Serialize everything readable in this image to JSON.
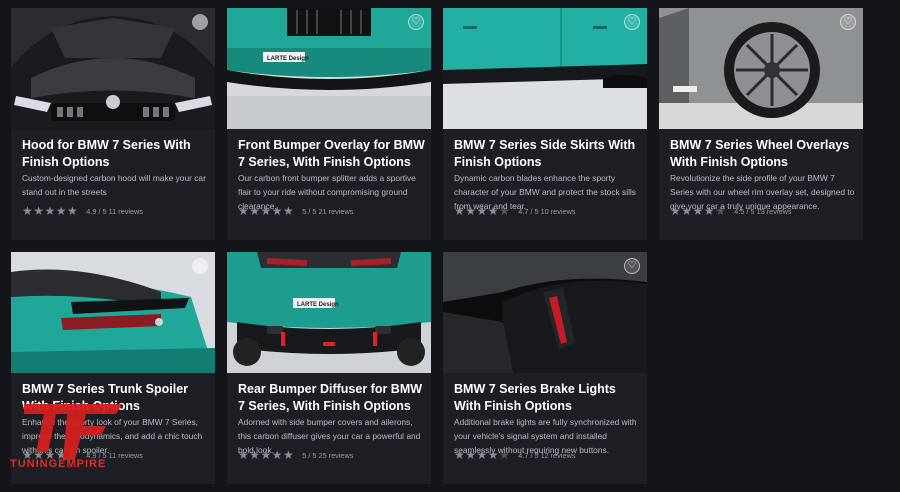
{
  "products": [
    {
      "title": "Hood for BMW 7 Series With Finish Options",
      "description": "Custom-designed carbon hood will make your car stand out in the streets",
      "rating_text": "4.9 / 5  11 reviews",
      "stars": 5,
      "image": "carbon-hood-photo"
    },
    {
      "title": "Front Bumper Overlay for BMW 7 Series, With Finish Options",
      "description": "Our carbon front bumper splitter adds a sportive flair to your ride without compromising ground clearance.",
      "rating_text": "5 / 5  21 reviews",
      "stars": 5,
      "image": "front-bumper-photo",
      "plate": "LARTE Design"
    },
    {
      "title": "BMW 7 Series Side Skirts With Finish Options",
      "description": "Dynamic carbon blades enhance the sporty character of your BMW and protect the stock sills from wear and tear.",
      "rating_text": "4.7 / 5  10 reviews",
      "stars": 4.5,
      "image": "side-skirts-photo"
    },
    {
      "title": "BMW 7 Series Wheel Overlays With Finish Options",
      "description": "Revolutionize the side profile of your BMW 7 Series with our wheel rim overlay set, designed to give your car a truly unique appearance.",
      "rating_text": "4.5 / 5  13 reviews",
      "stars": 4.5,
      "image": "wheel-overlay-photo"
    },
    {
      "title": "BMW 7 Series Trunk Spoiler With Finish Options",
      "description": "Enhance the sporty look of your BMW 7 Series, improve the aerodynamics, and add a chic touch with this carbon spoiler.",
      "rating_text": "4.9 / 5  11 reviews",
      "stars": 5,
      "image": "trunk-spoiler-photo"
    },
    {
      "title": "Rear Bumper Diffuser for BMW 7 Series, With Finish Options",
      "description": "Adorned with side bumper covers and ailerons, this carbon diffuser gives your car a powerful and bold look.",
      "rating_text": "5 / 5  25 reviews",
      "stars": 5,
      "image": "rear-diffuser-photo",
      "plate": "LARTE Design"
    },
    {
      "title": "BMW 7 Series Brake Lights With Finish Options",
      "description": "Additional brake lights are fully synchronized with your vehicle's signal system and installed seamlessly without requiring new buttons.",
      "rating_text": "4.7 / 5  12 reviews",
      "stars": 4.5,
      "image": "brake-lights-photo"
    }
  ],
  "watermark": {
    "text": "TUNINGEMPIRE",
    "logo": "tf-logo"
  },
  "colors": {
    "background": "#141518",
    "card": "#1d1f24",
    "teal": "#1fa89a",
    "accent_red": "#e12a2a"
  }
}
